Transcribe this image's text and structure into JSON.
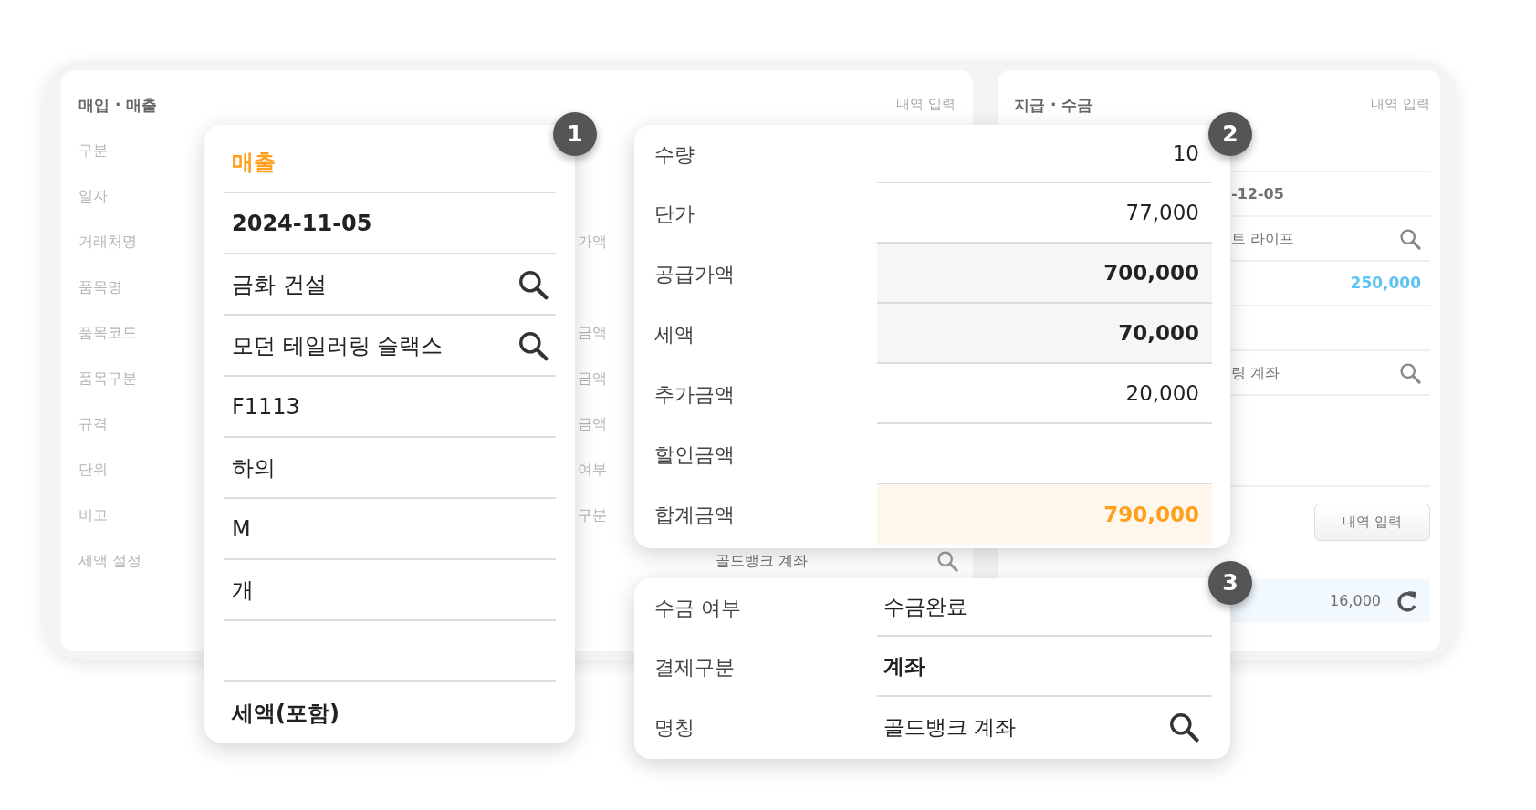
{
  "purchase_sales_panel": {
    "title": "매입 · 매출",
    "action": "내역 입력",
    "rows": [
      {
        "label": "구분"
      },
      {
        "label": "일자"
      },
      {
        "label": "거래처명",
        "column_2": "가액"
      },
      {
        "label": "품목명"
      },
      {
        "label": "품목코드",
        "column_2": "금액"
      },
      {
        "label": "품목구분",
        "column_2": "금액"
      },
      {
        "label": "규격",
        "column_2": "금액"
      },
      {
        "label": "단위",
        "column_2": "여부"
      },
      {
        "label": "비고",
        "column_2": "구분"
      },
      {
        "label": "세액 설정",
        "account": "골드뱅크 계좌"
      }
    ]
  },
  "payment_panel": {
    "title": "지급 · 수금",
    "action": "내역 입력",
    "rows": [
      {
        "kind": "blank"
      },
      {
        "kind": "text",
        "value": "-12-05"
      },
      {
        "kind": "lookup",
        "value": "트 라이프"
      },
      {
        "kind": "amount",
        "value": "250,000"
      },
      {
        "kind": "blank"
      },
      {
        "kind": "lookup",
        "value": "링 계좌"
      },
      {
        "kind": "spacer"
      }
    ],
    "button": "내역 입력",
    "history_amount": "16,000"
  },
  "sales_card": {
    "number": "1",
    "rows": [
      {
        "kind": "accent",
        "value": "매출"
      },
      {
        "kind": "strong",
        "value": "2024-11-05"
      },
      {
        "kind": "lookup",
        "value": "금화 건설"
      },
      {
        "kind": "lookup",
        "value": "모던 테일러링 슬랙스"
      },
      {
        "kind": "plain",
        "value": "F1113"
      },
      {
        "kind": "plain",
        "value": "하의"
      },
      {
        "kind": "plain",
        "value": "M"
      },
      {
        "kind": "plain",
        "value": "개"
      },
      {
        "kind": "blank"
      },
      {
        "kind": "strong",
        "value": "세액(포함)"
      }
    ]
  },
  "amount_card": {
    "number": "2",
    "rows": [
      {
        "kind": "plain",
        "label": "수량",
        "value": "10"
      },
      {
        "kind": "plain",
        "label": "단가",
        "value": "77,000"
      },
      {
        "kind": "shaded",
        "label": "공급가액",
        "value": "700,000"
      },
      {
        "kind": "shaded",
        "label": "세액",
        "value": "70,000"
      },
      {
        "kind": "plain",
        "label": "추가금액",
        "value": "20,000"
      },
      {
        "kind": "plain",
        "label": "할인금액"
      },
      {
        "kind": "total",
        "label": "합계금액",
        "value": "790,000"
      }
    ]
  },
  "payment_card": {
    "number": "3",
    "rows": [
      {
        "kind": "plain",
        "label": "수금 여부",
        "value": "수금완료"
      },
      {
        "kind": "strong",
        "label": "결제구분",
        "value": "계좌"
      },
      {
        "kind": "lookup",
        "label": "명칭",
        "value": "골드뱅크 계좌"
      }
    ]
  }
}
